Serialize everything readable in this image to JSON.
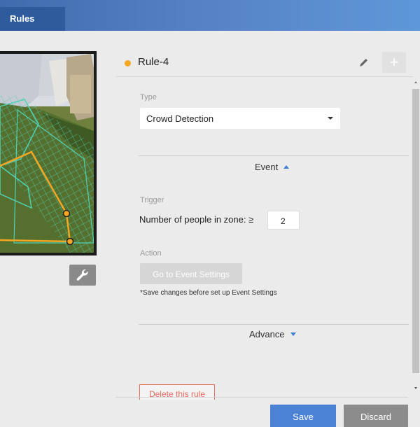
{
  "header": {
    "tab_label": "Rules"
  },
  "rule": {
    "name": "Rule-4",
    "status_color": "#f5a623",
    "edit_icon": "pencil-icon",
    "add_icon": "plus-icon",
    "add_label": "+"
  },
  "type_section": {
    "label": "Type",
    "selected": "Crowd Detection"
  },
  "event_section": {
    "header": "Event",
    "trigger_label": "Trigger",
    "trigger_text": "Number of people in zone:  ≥",
    "trigger_value": "2",
    "action_label": "Action",
    "action_button": "Go to Event Settings",
    "action_note": "*Save changes before set up Event Settings"
  },
  "advance_section": {
    "header": "Advance"
  },
  "delete_button": "Delete this rule",
  "footer": {
    "save_label": "Save",
    "discard_label": "Discard"
  },
  "camera": {
    "settings_icon": "wrench-icon"
  },
  "colors": {
    "accent": "#4c82d6",
    "header_dark": "#2e5b9c",
    "zone_line": "#f5a623",
    "zone_grid": "#4fd1b5",
    "delete": "#e56b5b"
  }
}
